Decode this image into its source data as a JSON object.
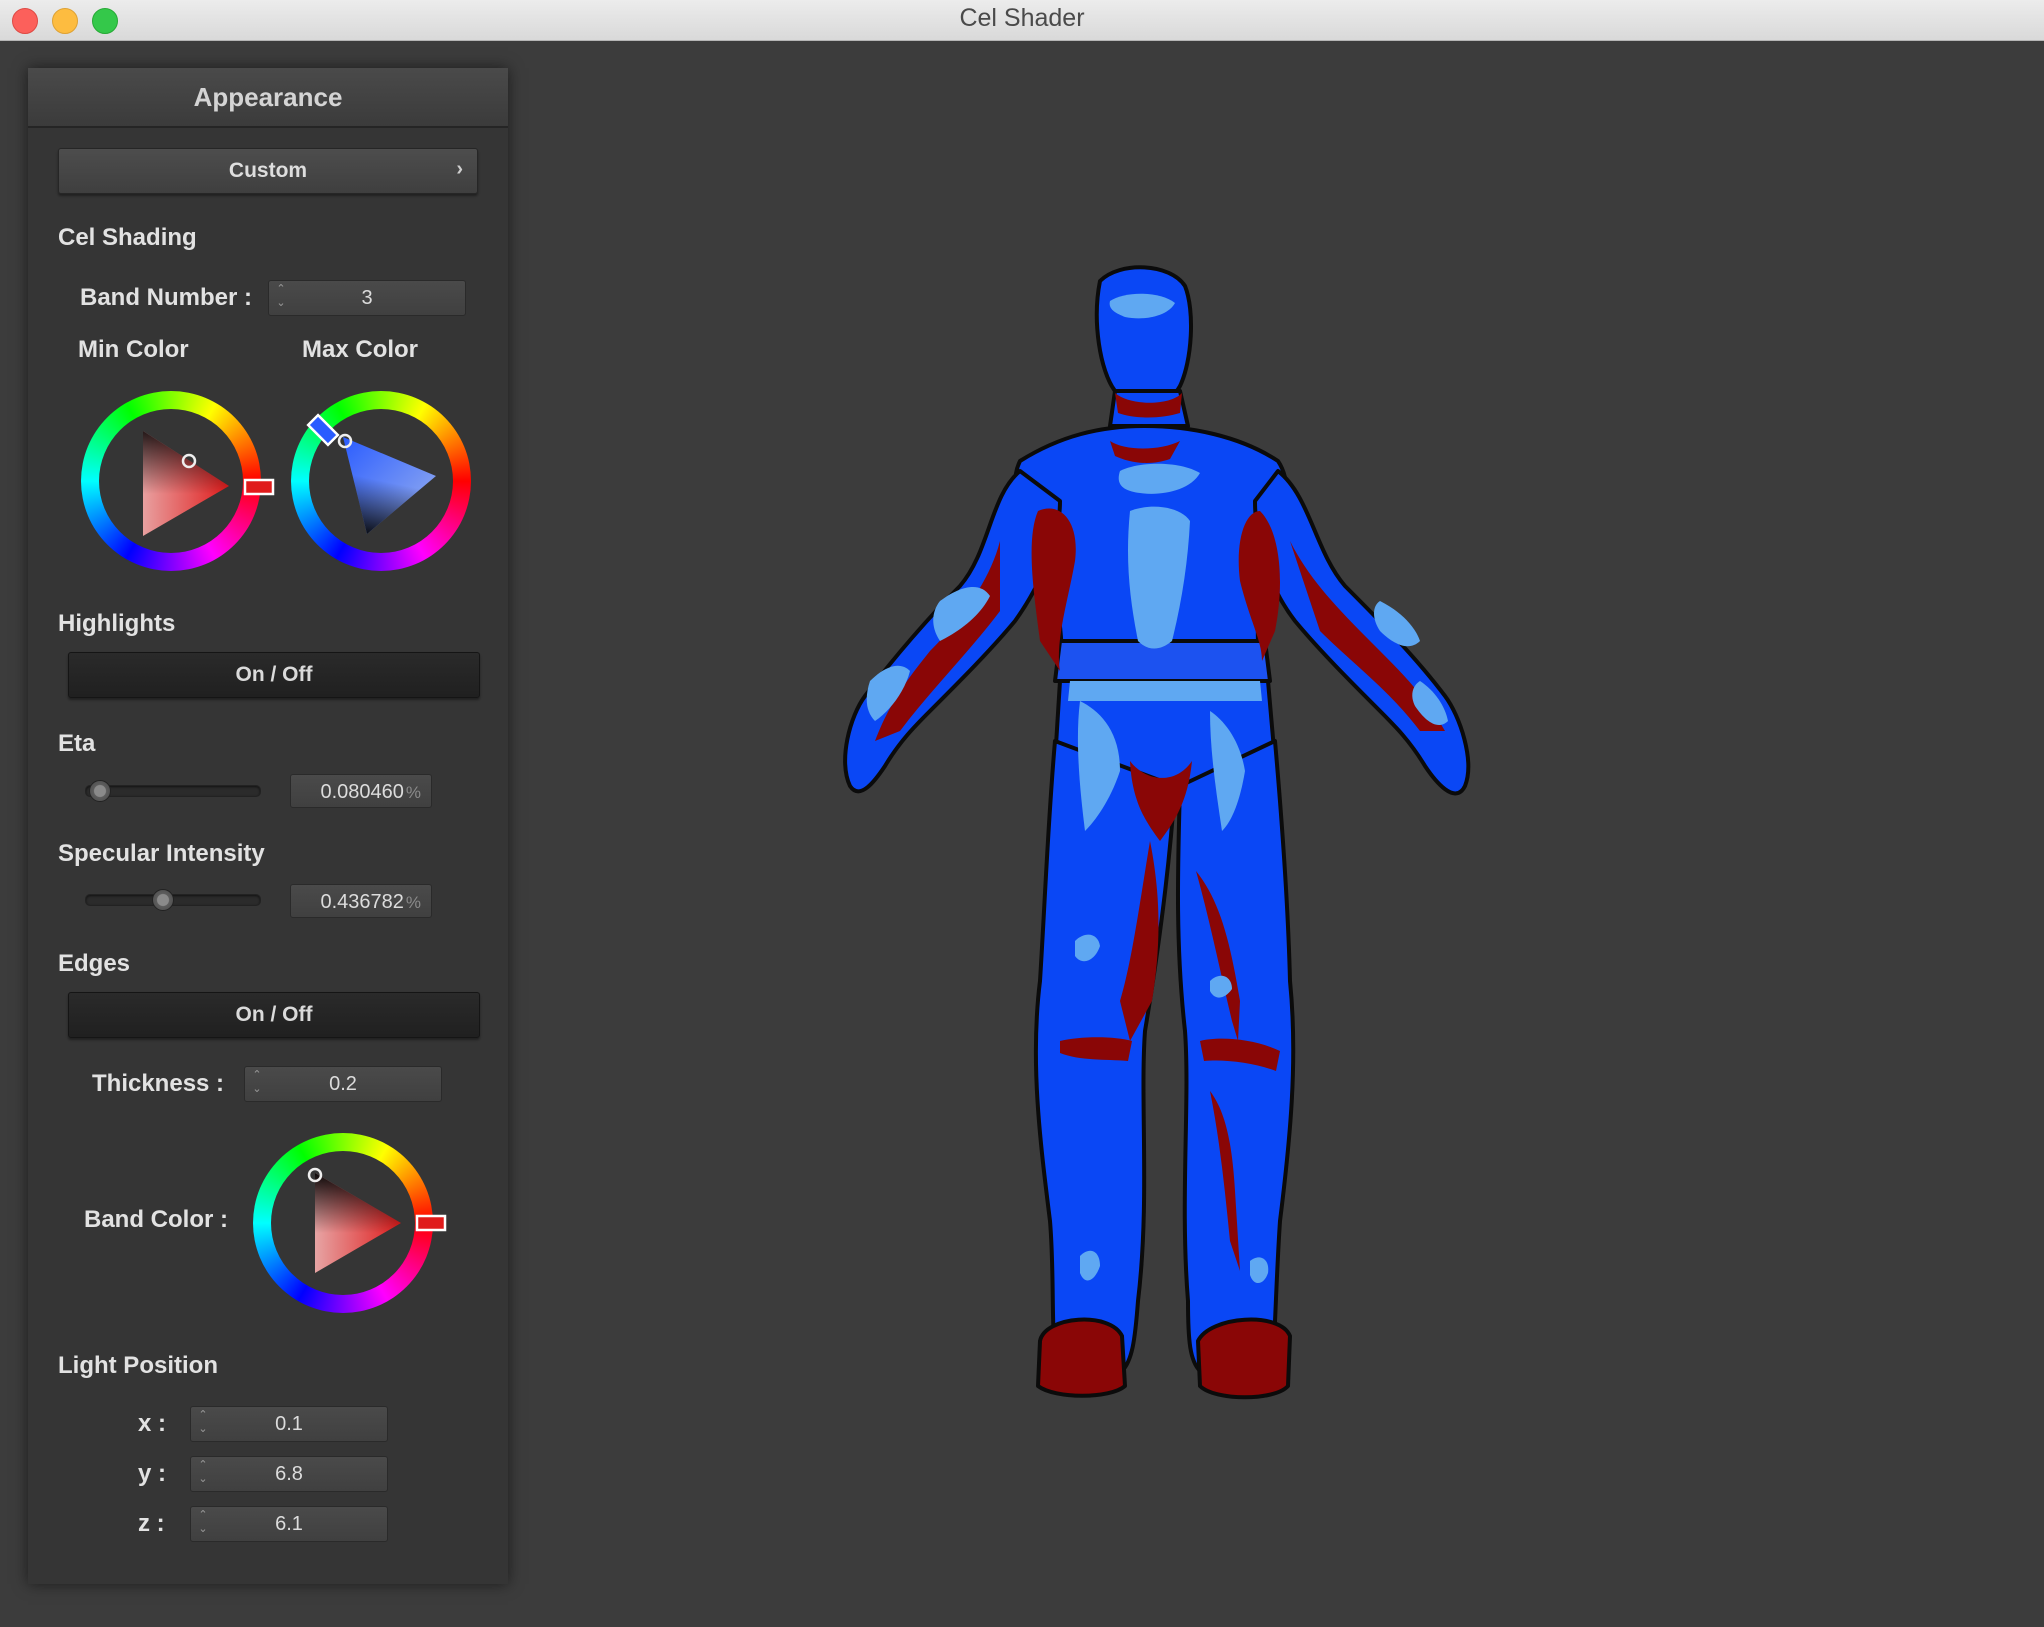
{
  "window": {
    "title": "Cel Shader"
  },
  "panel": {
    "header": "Appearance",
    "preset": {
      "label": "Custom",
      "chevron": "›"
    },
    "cel_shading": {
      "heading": "Cel Shading",
      "band_number_label": "Band Number :",
      "band_number_value": "3",
      "min_color_label": "Min Color",
      "max_color_label": "Max Color",
      "min_color": "#e01b1b",
      "max_color": "#2a5cff"
    },
    "highlights": {
      "heading": "Highlights",
      "toggle_label": "On / Off",
      "eta_label": "Eta",
      "eta_value": "0.080460",
      "eta_unit": "%",
      "eta_level": 0.08,
      "specular_label": "Specular Intensity",
      "specular_value": "0.436782",
      "specular_unit": "%",
      "specular_level": 0.44
    },
    "edges": {
      "heading": "Edges",
      "toggle_label": "On / Off",
      "thickness_label": "Thickness :",
      "thickness_value": "0.2",
      "band_color_label": "Band Color :",
      "band_color": "#e01b1b"
    },
    "light_position": {
      "heading": "Light Position",
      "x_label": "x :",
      "x_value": "0.1",
      "y_label": "y :",
      "y_value": "6.8",
      "z_label": "z :",
      "z_value": "6.1"
    }
  },
  "viewport": {
    "model": "human-figure",
    "colors": {
      "base": "#0a47f5",
      "highlight": "#5fa8f2",
      "shadow": "#8a0606",
      "outline": "#0b0b0b",
      "background": "#3c3c3c"
    }
  }
}
